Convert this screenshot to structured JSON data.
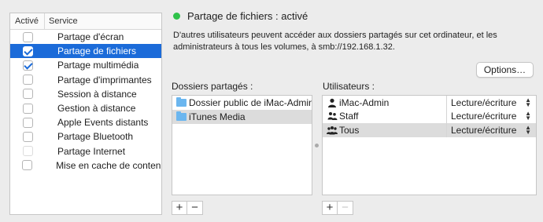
{
  "services": {
    "header_active": "Activé",
    "header_service": "Service",
    "items": [
      {
        "label": "Partage d'écran",
        "checked": false,
        "selected": false,
        "disabled": false
      },
      {
        "label": "Partage de fichiers",
        "checked": true,
        "selected": true,
        "disabled": false
      },
      {
        "label": "Partage multimédia",
        "checked": true,
        "selected": false,
        "disabled": false
      },
      {
        "label": "Partage d'imprimantes",
        "checked": false,
        "selected": false,
        "disabled": false
      },
      {
        "label": "Session à distance",
        "checked": false,
        "selected": false,
        "disabled": false
      },
      {
        "label": "Gestion à distance",
        "checked": false,
        "selected": false,
        "disabled": false
      },
      {
        "label": "Apple Events distants",
        "checked": false,
        "selected": false,
        "disabled": false
      },
      {
        "label": "Partage Bluetooth",
        "checked": false,
        "selected": false,
        "disabled": false
      },
      {
        "label": "Partage Internet",
        "checked": false,
        "selected": false,
        "disabled": true
      },
      {
        "label": "Mise en cache de contenu",
        "checked": false,
        "selected": false,
        "disabled": false
      }
    ]
  },
  "status": {
    "text": "Partage de fichiers : activé",
    "color": "#2fc24a"
  },
  "description": "D'autres utilisateurs peuvent accéder aux dossiers partagés sur cet ordinateur, et les administrateurs à tous les volumes, à smb://192.168.1.32.",
  "options_button": "Options…",
  "shared_folders": {
    "label": "Dossiers partagés :",
    "items": [
      {
        "label": "Dossier public de iMac-Admin",
        "icon": "public-folder-icon",
        "selected": false
      },
      {
        "label": "iTunes Media",
        "icon": "folder-icon",
        "selected": true
      }
    ]
  },
  "users": {
    "label": "Utilisateurs :",
    "items": [
      {
        "name": "iMac-Admin",
        "icon": "user-icon",
        "permission": "Lecture/écriture",
        "selected": false
      },
      {
        "name": "Staff",
        "icon": "group-icon",
        "permission": "Lecture/écriture",
        "selected": false
      },
      {
        "name": "Tous",
        "icon": "everyone-icon",
        "permission": "Lecture/écriture",
        "selected": true
      }
    ]
  },
  "buttons": {
    "add": "+",
    "remove": "−"
  },
  "colors": {
    "selection": "#1b6bd9",
    "row_highlight": "#dcdcdc"
  }
}
